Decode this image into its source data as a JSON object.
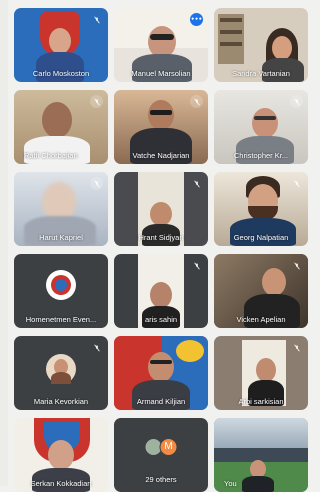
{
  "participants": [
    {
      "name": "Carlo Moskoston",
      "muted": true
    },
    {
      "name": "Manuel Marsolian",
      "speaking": true,
      "speaking_label": "•••"
    },
    {
      "name": "Sandra Vartanian"
    },
    {
      "name": "Raffi Chorbajian",
      "muted": true
    },
    {
      "name": "Vatche Nadjarian",
      "muted": true
    },
    {
      "name": "Christopher Kr...",
      "muted": true
    },
    {
      "name": "Harut Kapriel",
      "muted": true
    },
    {
      "name": "Hrant Sidjyan",
      "muted": true
    },
    {
      "name": "Georg Nalpatian",
      "muted": true
    },
    {
      "name": "Homenetmen Even...",
      "muted": true
    },
    {
      "name": "aris sahin",
      "muted": true
    },
    {
      "name": "Vicken Apelian",
      "muted": true
    },
    {
      "name": "Maria Kevorkian",
      "muted": true
    },
    {
      "name": "Armand Kiljian",
      "muted": true
    },
    {
      "name": "Arbi sarkisian",
      "muted": true
    },
    {
      "name": "Serkan Kokkadian",
      "muted": true
    },
    {
      "name": "29 others",
      "others_initial": "M"
    },
    {
      "name": "You"
    }
  ],
  "colors": {
    "tile_bg": "#3c4043",
    "speaking_indicator": "#1a73e8",
    "page_bg": "#f1f1ef",
    "avatar_orange": "#f28b44"
  }
}
